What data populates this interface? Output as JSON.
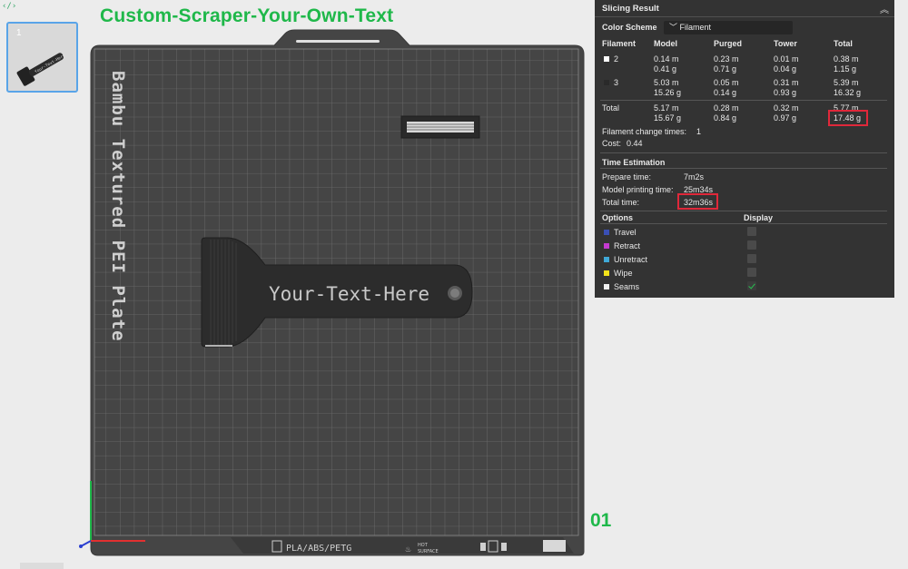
{
  "title": "Custom-Scraper-Your-Own-Text",
  "plate_number": "01",
  "thumbnail": {
    "index": "1",
    "label": "Your-Text-Here"
  },
  "bed": {
    "name": "Bambu Textured PEI Plate",
    "model_text": "Your-Text-Here",
    "bottom_label": "PLA/ABS/PETG",
    "hot_label_1": "HOT",
    "hot_label_2": "SURFACE"
  },
  "result": {
    "title": "Slicing Result",
    "color_scheme_label": "Color Scheme",
    "color_scheme_value": "Filament",
    "headers": {
      "filament": "Filament",
      "model": "Model",
      "purged": "Purged",
      "tower": "Tower",
      "total": "Total"
    },
    "rows": [
      {
        "filament": "2",
        "color": "#ffffff",
        "model_m": "0.14 m",
        "model_g": "0.41 g",
        "purged_m": "0.23 m",
        "purged_g": "0.71 g",
        "tower_m": "0.01 m",
        "tower_g": "0.04 g",
        "total_m": "0.38 m",
        "total_g": "1.15 g"
      },
      {
        "filament": "3",
        "color": "#2a2a2a",
        "model_m": "5.03 m",
        "model_g": "15.26 g",
        "purged_m": "0.05 m",
        "purged_g": "0.14 g",
        "tower_m": "0.31 m",
        "tower_g": "0.93 g",
        "total_m": "5.39 m",
        "total_g": "16.32 g"
      }
    ],
    "totals": {
      "label": "Total",
      "model_m": "5.17 m",
      "model_g": "15.67 g",
      "purged_m": "0.28 m",
      "purged_g": "0.84 g",
      "tower_m": "0.32 m",
      "tower_g": "0.97 g",
      "total_m": "5.77 m",
      "total_g": "17.48 g"
    },
    "filament_change_label": "Filament change times:",
    "filament_change_value": "1",
    "cost_label": "Cost:",
    "cost_value": "0.44",
    "time_title": "Time Estimation",
    "prepare_label": "Prepare time:",
    "prepare_value": "7m2s",
    "model_time_label": "Model printing time:",
    "model_time_value": "25m34s",
    "total_time_label": "Total time:",
    "total_time_value": "32m36s",
    "options_title": "Options",
    "display_title": "Display",
    "options": [
      {
        "label": "Travel",
        "color": "#3a4fb5",
        "checked": false
      },
      {
        "label": "Retract",
        "color": "#c43ad0",
        "checked": false
      },
      {
        "label": "Unretract",
        "color": "#3fa9d8",
        "checked": false
      },
      {
        "label": "Wipe",
        "color": "#f2e21a",
        "checked": false
      },
      {
        "label": "Seams",
        "color": "#f0f0f0",
        "checked": true
      }
    ]
  }
}
